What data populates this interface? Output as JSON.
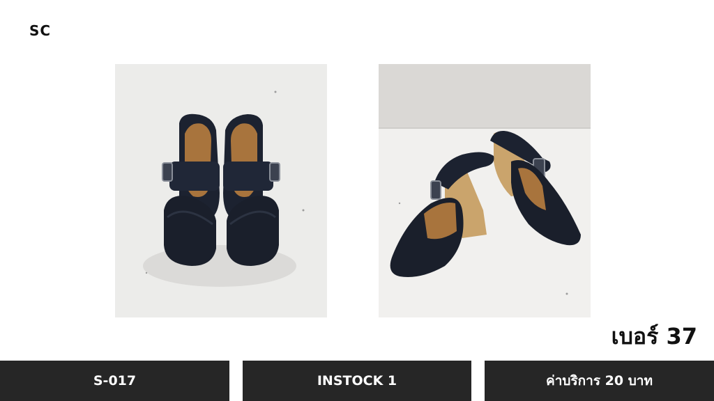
{
  "brand": "SC",
  "size_label": "เบอร์ 37",
  "info": {
    "code": "S-017",
    "stock": "INSTOCK 1",
    "fee": "ค่าบริการ 20 บาท"
  },
  "colors": {
    "bar_bg": "#262626",
    "bar_text": "#ffffff",
    "shoe_leather": "#1c2230",
    "insole": "#a8743d",
    "wedge": "#caa46c"
  }
}
